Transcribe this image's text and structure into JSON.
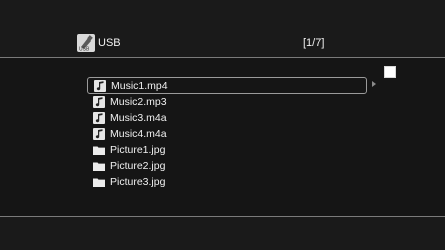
{
  "header": {
    "source_icon": "usb-drive-icon",
    "source_label": "USB",
    "page_counter": "[1/7]"
  },
  "selection_checkbox": {
    "checked": false
  },
  "file_list": {
    "selected_index": 0,
    "items": [
      {
        "name": "Music1.mp4",
        "icon": "music-note-icon"
      },
      {
        "name": "Music2.mp3",
        "icon": "music-note-icon"
      },
      {
        "name": "Music3.m4a",
        "icon": "music-note-icon"
      },
      {
        "name": "Music4.m4a",
        "icon": "music-note-icon"
      },
      {
        "name": "Picture1.jpg",
        "icon": "folder-icon"
      },
      {
        "name": "Picture2.jpg",
        "icon": "folder-icon"
      },
      {
        "name": "Picture3.jpg",
        "icon": "folder-icon"
      }
    ]
  }
}
